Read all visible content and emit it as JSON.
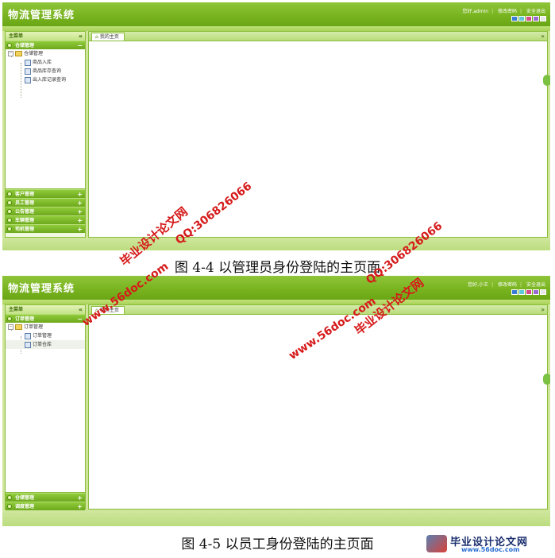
{
  "app_title": "物流管理系统",
  "skin_colors": [
    "#3a7bd5",
    "#5fc8d8",
    "#d44a8a",
    "#9a6ad0",
    "#e8e8e8"
  ],
  "screen_admin": {
    "greeting": "您好,admin",
    "change_password": "修改密码",
    "safe_exit": "安全退出",
    "main_menu": "主菜单",
    "open_section": "仓储管理",
    "tree_root": "仓储管理",
    "tree_items": [
      "商品入库",
      "商品库存查询",
      "出入库记录查询"
    ],
    "collapsed_sections": [
      "客户管理",
      "员工管理",
      "公告管理",
      "车辆管理",
      "司机管理"
    ],
    "tab_label": "我的主页",
    "caption": "图 4-4 以管理员身份登陆的主页面"
  },
  "screen_staff": {
    "greeting": "您好,小王",
    "change_password": "修改密码",
    "safe_exit": "安全退出",
    "main_menu": "主菜单",
    "open_section": "订单管理",
    "tree_root": "订单管理",
    "tree_items": [
      "订单管理",
      "订单仓库"
    ],
    "collapsed_sections": [
      "仓储管理",
      "调度管理"
    ],
    "tab_label": "我的主页",
    "caption": "图 4-5 以员工身份登陆的主页面"
  },
  "watermark": {
    "site_cn": "毕业设计论文网",
    "site_url": "www.56doc.com",
    "qq": "QQ:306826066"
  },
  "logo": {
    "name": "毕业设计论文网",
    "url": "www.56doc.com"
  }
}
